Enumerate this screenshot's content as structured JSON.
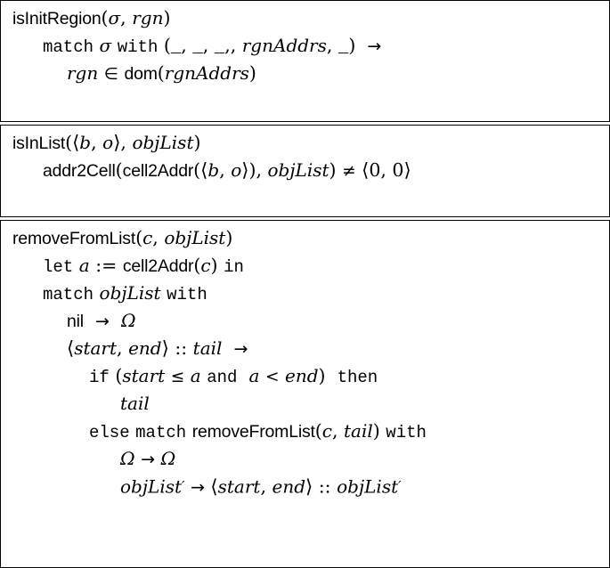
{
  "figure": {
    "kind": "pseudocode-definitions",
    "box_count": 3,
    "background_color": "#ffffff",
    "border_color": "#000000",
    "text_color": "#000000"
  },
  "boxes": [
    {
      "name": "isInitRegion",
      "lines": [
        {
          "indent": 0,
          "text": "isInitRegion(σ, rgn)",
          "tokens": [
            {
              "t": "fn",
              "s": "isInitRegion"
            },
            {
              "t": "sym",
              "s": "("
            },
            {
              "t": "greek",
              "s": "σ"
            },
            {
              "t": "sym",
              "s": ", "
            },
            {
              "t": "var",
              "s": "rgn"
            },
            {
              "t": "sym",
              "s": ")"
            }
          ]
        },
        {
          "indent": 1,
          "text": "match σ with (_, _, _,, rgnAddrs, _)  →",
          "tokens": [
            {
              "t": "kw",
              "s": "match"
            },
            {
              "t": "sp",
              "s": " "
            },
            {
              "t": "greek",
              "s": "σ"
            },
            {
              "t": "sp",
              "s": " "
            },
            {
              "t": "kw",
              "s": "with"
            },
            {
              "t": "sp",
              "s": " "
            },
            {
              "t": "sym",
              "s": "("
            },
            {
              "t": "us",
              "s": "_"
            },
            {
              "t": "sym",
              "s": ", "
            },
            {
              "t": "us",
              "s": "_"
            },
            {
              "t": "sym",
              "s": ", "
            },
            {
              "t": "us",
              "s": "_"
            },
            {
              "t": "sym",
              "s": ",, "
            },
            {
              "t": "var",
              "s": "rgnAddrs"
            },
            {
              "t": "sym",
              "s": ", "
            },
            {
              "t": "us",
              "s": "_"
            },
            {
              "t": "sym",
              "s": ")"
            },
            {
              "t": "sp",
              "s": "  "
            },
            {
              "t": "arr",
              "s": "→"
            }
          ]
        },
        {
          "indent": 2,
          "text": "rgn ∈ dom(rgnAddrs)",
          "tokens": [
            {
              "t": "var",
              "s": "rgn"
            },
            {
              "t": "sp",
              "s": " "
            },
            {
              "t": "rel",
              "s": "∈"
            },
            {
              "t": "sp",
              "s": " "
            },
            {
              "t": "fn",
              "s": "dom"
            },
            {
              "t": "sym",
              "s": "("
            },
            {
              "t": "var",
              "s": "rgnAddrs"
            },
            {
              "t": "sym",
              "s": ")"
            }
          ]
        }
      ]
    },
    {
      "name": "isInList",
      "lines": [
        {
          "indent": 0,
          "text": "isInList(⟨b, o⟩, objList)",
          "tokens": [
            {
              "t": "fn",
              "s": "isInList"
            },
            {
              "t": "sym",
              "s": "("
            },
            {
              "t": "ang",
              "s": "⟨"
            },
            {
              "t": "var",
              "s": "b"
            },
            {
              "t": "sym",
              "s": ", "
            },
            {
              "t": "var",
              "s": "o"
            },
            {
              "t": "ang",
              "s": "⟩"
            },
            {
              "t": "sym",
              "s": ", "
            },
            {
              "t": "var",
              "s": "objList"
            },
            {
              "t": "sym",
              "s": ")"
            }
          ]
        },
        {
          "indent": 1,
          "text": "addr2Cell(cell2Addr(⟨b, o⟩), objList) ≠ ⟨0, 0⟩",
          "tokens": [
            {
              "t": "fn",
              "s": "addr2Cell"
            },
            {
              "t": "sym",
              "s": "("
            },
            {
              "t": "fn",
              "s": "cell2Addr"
            },
            {
              "t": "sym",
              "s": "("
            },
            {
              "t": "ang",
              "s": "⟨"
            },
            {
              "t": "var",
              "s": "b"
            },
            {
              "t": "sym",
              "s": ", "
            },
            {
              "t": "var",
              "s": "o"
            },
            {
              "t": "ang",
              "s": "⟩"
            },
            {
              "t": "sym",
              "s": "), "
            },
            {
              "t": "var",
              "s": "objList"
            },
            {
              "t": "sym",
              "s": ")"
            },
            {
              "t": "sp",
              "s": " "
            },
            {
              "t": "rel",
              "s": "≠"
            },
            {
              "t": "sp",
              "s": " "
            },
            {
              "t": "ang",
              "s": "⟨"
            },
            {
              "t": "sym",
              "s": "0, 0"
            },
            {
              "t": "ang",
              "s": "⟩"
            }
          ]
        }
      ]
    },
    {
      "name": "removeFromList",
      "lines": [
        {
          "indent": 0,
          "text": "removeFromList(c, objList)",
          "tokens": [
            {
              "t": "fn",
              "s": "removeFromList"
            },
            {
              "t": "sym",
              "s": "("
            },
            {
              "t": "var",
              "s": "c"
            },
            {
              "t": "sym",
              "s": ", "
            },
            {
              "t": "var",
              "s": "objList"
            },
            {
              "t": "sym",
              "s": ")"
            }
          ]
        },
        {
          "indent": 1,
          "text": "let a := cell2Addr(c) in",
          "tokens": [
            {
              "t": "kw",
              "s": "let"
            },
            {
              "t": "sp",
              "s": " "
            },
            {
              "t": "var",
              "s": "a"
            },
            {
              "t": "sp",
              "s": " "
            },
            {
              "t": "sym",
              "s": ":="
            },
            {
              "t": "sp",
              "s": " "
            },
            {
              "t": "fn",
              "s": "cell2Addr"
            },
            {
              "t": "sym",
              "s": "("
            },
            {
              "t": "var",
              "s": "c"
            },
            {
              "t": "sym",
              "s": ")"
            },
            {
              "t": "sp",
              "s": " "
            },
            {
              "t": "kw",
              "s": "in"
            }
          ]
        },
        {
          "indent": 1,
          "text": "match objList with",
          "tokens": [
            {
              "t": "kw",
              "s": "match"
            },
            {
              "t": "sp",
              "s": " "
            },
            {
              "t": "var",
              "s": "objList"
            },
            {
              "t": "sp",
              "s": " "
            },
            {
              "t": "kw",
              "s": "with"
            }
          ]
        },
        {
          "indent": 2,
          "text": "nil  →  Ω",
          "tokens": [
            {
              "t": "fn",
              "s": "nil"
            },
            {
              "t": "sp",
              "s": "  "
            },
            {
              "t": "arr",
              "s": "→"
            },
            {
              "t": "sp",
              "s": "  "
            },
            {
              "t": "greek",
              "s": "Ω"
            }
          ]
        },
        {
          "indent": 2,
          "text": "⟨start, end⟩ :: tail  →",
          "tokens": [
            {
              "t": "ang",
              "s": "⟨"
            },
            {
              "t": "var",
              "s": "start"
            },
            {
              "t": "sym",
              "s": ", "
            },
            {
              "t": "var",
              "s": "end"
            },
            {
              "t": "ang",
              "s": "⟩"
            },
            {
              "t": "sym",
              "s": " :: "
            },
            {
              "t": "var",
              "s": "tail"
            },
            {
              "t": "sp",
              "s": "  "
            },
            {
              "t": "arr",
              "s": "→"
            }
          ]
        },
        {
          "indent": 3,
          "text": "if (start ≤ a and  a < end)  then",
          "tokens": [
            {
              "t": "kw",
              "s": "if"
            },
            {
              "t": "sp",
              "s": " "
            },
            {
              "t": "sym",
              "s": "("
            },
            {
              "t": "var",
              "s": "start"
            },
            {
              "t": "sp",
              "s": " "
            },
            {
              "t": "rel",
              "s": "≤"
            },
            {
              "t": "sp",
              "s": " "
            },
            {
              "t": "var",
              "s": "a"
            },
            {
              "t": "sp",
              "s": " "
            },
            {
              "t": "kw",
              "s": "and"
            },
            {
              "t": "sp",
              "s": "  "
            },
            {
              "t": "var",
              "s": "a"
            },
            {
              "t": "sp",
              "s": " "
            },
            {
              "t": "rel",
              "s": "<"
            },
            {
              "t": "sp",
              "s": " "
            },
            {
              "t": "var",
              "s": "end"
            },
            {
              "t": "sym",
              "s": ")"
            },
            {
              "t": "sp",
              "s": "  "
            },
            {
              "t": "kw",
              "s": "then"
            }
          ]
        },
        {
          "indent": 4,
          "text": "tail",
          "tokens": [
            {
              "t": "var",
              "s": "tail"
            }
          ]
        },
        {
          "indent": 3,
          "text": "else match removeFromList(c, tail) with",
          "tokens": [
            {
              "t": "kw",
              "s": "else"
            },
            {
              "t": "sp",
              "s": " "
            },
            {
              "t": "kw",
              "s": "match"
            },
            {
              "t": "sp",
              "s": " "
            },
            {
              "t": "fn",
              "s": "removeFromList"
            },
            {
              "t": "sym",
              "s": "("
            },
            {
              "t": "var",
              "s": "c"
            },
            {
              "t": "sym",
              "s": ", "
            },
            {
              "t": "var",
              "s": "tail"
            },
            {
              "t": "sym",
              "s": ")"
            },
            {
              "t": "sp",
              "s": " "
            },
            {
              "t": "kw",
              "s": "with"
            }
          ]
        },
        {
          "indent": 4,
          "text": "Ω → Ω",
          "tokens": [
            {
              "t": "greek",
              "s": "Ω"
            },
            {
              "t": "sp",
              "s": " "
            },
            {
              "t": "arr",
              "s": "→"
            },
            {
              "t": "sp",
              "s": " "
            },
            {
              "t": "greek",
              "s": "Ω"
            }
          ]
        },
        {
          "indent": 4,
          "text": "objList′ → ⟨start, end⟩ :: objList′",
          "tokens": [
            {
              "t": "var",
              "s": "objList"
            },
            {
              "t": "prime",
              "s": "′"
            },
            {
              "t": "sp",
              "s": " "
            },
            {
              "t": "arr",
              "s": "→"
            },
            {
              "t": "sp",
              "s": " "
            },
            {
              "t": "ang",
              "s": "⟨"
            },
            {
              "t": "var",
              "s": "start"
            },
            {
              "t": "sym",
              "s": ", "
            },
            {
              "t": "var",
              "s": "end"
            },
            {
              "t": "ang",
              "s": "⟩"
            },
            {
              "t": "sym",
              "s": " :: "
            },
            {
              "t": "var",
              "s": "objList"
            },
            {
              "t": "prime",
              "s": "′"
            }
          ]
        }
      ]
    }
  ]
}
